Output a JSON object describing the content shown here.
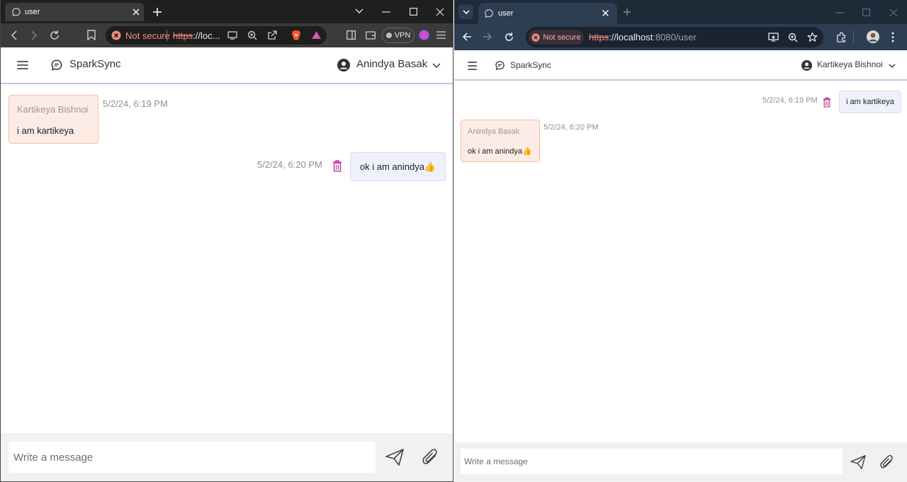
{
  "left_window": {
    "tab_title": "user",
    "not_secure": "Not secure",
    "url_scheme": "https",
    "url_rest": "://loc...",
    "vpn_label": "VPN",
    "app": {
      "brand": "SparkSync",
      "user_name": "Anindya Basak",
      "messages": [
        {
          "type": "received",
          "sender": "Kartikeya Bishnoi",
          "text": "i am kartikeya",
          "time": "5/2/24, 6:19 PM"
        },
        {
          "type": "sent",
          "text": "ok i am anindya👍",
          "time": "5/2/24, 6:20 PM"
        }
      ],
      "composer_placeholder": "Write a message"
    }
  },
  "right_window": {
    "tab_title": "user",
    "not_secure": "Not secure",
    "url_scheme": "https",
    "url_host": "://localhost",
    "url_path": ":8080/user",
    "app": {
      "brand": "SparkSync",
      "user_name": "Kartikeya Bishnoi",
      "messages": [
        {
          "type": "sent",
          "text": "i am kartikeya",
          "time": "5/2/24, 6:19 PM"
        },
        {
          "type": "received",
          "sender": "Anindya Basak",
          "text": "ok i am anindya👍",
          "time": "5/2/24, 6:20 PM"
        }
      ],
      "composer_placeholder": "Write a message"
    }
  },
  "icons": [
    "chat-bubble-icon",
    "close-icon",
    "plus-icon",
    "chevron-down-icon",
    "minimize-icon",
    "maximize-icon",
    "back-icon",
    "forward-icon",
    "reload-icon",
    "bookmark-icon",
    "warning-icon",
    "cast-icon",
    "zoom-icon",
    "share-icon",
    "brave-lion-icon",
    "rewards-triangle-icon",
    "sidebar-icon",
    "wallet-icon",
    "leo-ai-icon",
    "menu-icon",
    "star-icon",
    "extensions-icon",
    "profile-avatar-icon",
    "kebab-menu-icon",
    "hamburger-icon",
    "account-circle-icon",
    "trash-icon",
    "send-icon",
    "paperclip-icon"
  ],
  "colors": {
    "brave_tabbar": "#1f1f1f",
    "brave_toolbar": "#3b3b3b",
    "chrome_tabbar": "#1e2a38",
    "chrome_toolbar": "#2d3d52",
    "received_bubble_bg": "#fdebe6",
    "received_bubble_border": "#f3c29e",
    "sent_bubble_bg": "#eef0fb",
    "trash_icon": "#c0399b",
    "header_divider": "#c9c6ea"
  }
}
